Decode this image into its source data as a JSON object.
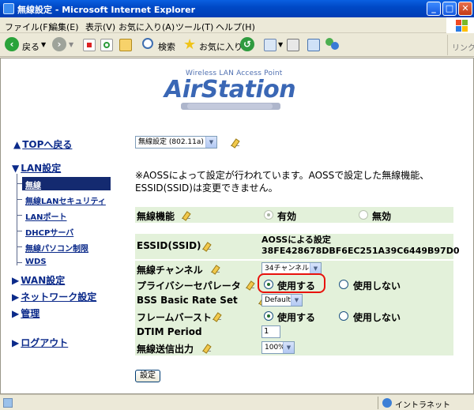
{
  "window": {
    "title": "無線設定 - Microsoft Internet Explorer"
  },
  "menu": [
    "ファイル(F)",
    "編集(E)",
    "表示(V)",
    "お気に入り(A)",
    "ツール(T)",
    "ヘルプ(H)"
  ],
  "toolbar": {
    "back": "戻る",
    "search": "検索",
    "favorites": "お気に入り",
    "links": "リンク"
  },
  "logo": {
    "subtitle": "Wireless LAN Access Point",
    "title": "AirStation"
  },
  "nav": {
    "top": "TOPへ戻る",
    "lan": "LAN設定",
    "sub": [
      "無線",
      "無線LANセキュリティ",
      "LANポート",
      "DHCPサーバ",
      "無線パソコン制限",
      "WDS"
    ],
    "wan": "WAN設定",
    "network": "ネットワーク設定",
    "admin": "管理",
    "logout": "ログアウト"
  },
  "mode_select": "無線設定 (802.11a)",
  "notice": "※AOSSによって設定が行われています。AOSSで設定した無線機能、ESSID(SSID)は変更できません。",
  "form": {
    "wireless": {
      "label": "無線機能",
      "on": "有効",
      "off": "無効"
    },
    "essid": {
      "label": "ESSID(SSID)",
      "line1": "AOSSによる設定",
      "line2": "38FE428678DBF6EC251A39C6449B97D0"
    },
    "channel": {
      "label": "無線チャンネル",
      "value": "34チャンネル"
    },
    "privacy": {
      "label": "プライバシーセパレータ",
      "use": "使用する",
      "nouse": "使用しない"
    },
    "bss": {
      "label": "BSS Basic Rate Set",
      "value": "Default"
    },
    "frame": {
      "label": "フレームバースト",
      "use": "使用する",
      "nouse": "使用しない"
    },
    "dtim": {
      "label": "DTIM Period",
      "value": "1"
    },
    "power": {
      "label": "無線送信出力",
      "value": "100%"
    }
  },
  "submit": "設定",
  "status": {
    "zone": "イントラネット"
  }
}
